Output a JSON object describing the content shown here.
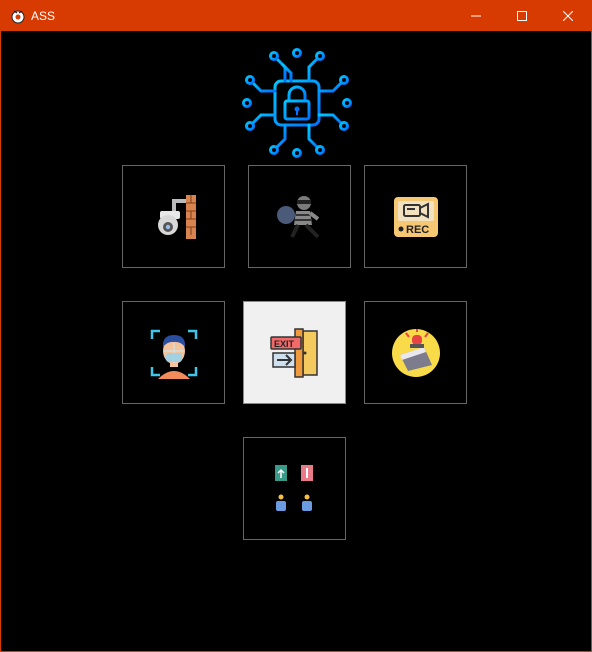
{
  "window": {
    "title": "ASS",
    "title_bar_color": "#d83b01",
    "controls": [
      "minimize-icon",
      "maximize-icon",
      "close-icon"
    ]
  },
  "logo": {
    "icon": "circuit-padlock-icon",
    "color": "#1e90ff"
  },
  "tiles": [
    {
      "icon": "cctv-camera-wall-icon",
      "state": "normal"
    },
    {
      "icon": "running-thief-icon",
      "state": "normal"
    },
    {
      "icon": "video-recorder-rec-icon",
      "state": "normal",
      "label": "REC"
    },
    {
      "icon": "face-recognition-icon",
      "state": "normal"
    },
    {
      "icon": "exit-door-icon",
      "state": "highlighted",
      "label": "EXIT"
    },
    {
      "icon": "alarm-siren-icon",
      "state": "normal"
    },
    {
      "icon": "entry-exit-people-icon",
      "state": "normal"
    }
  ]
}
